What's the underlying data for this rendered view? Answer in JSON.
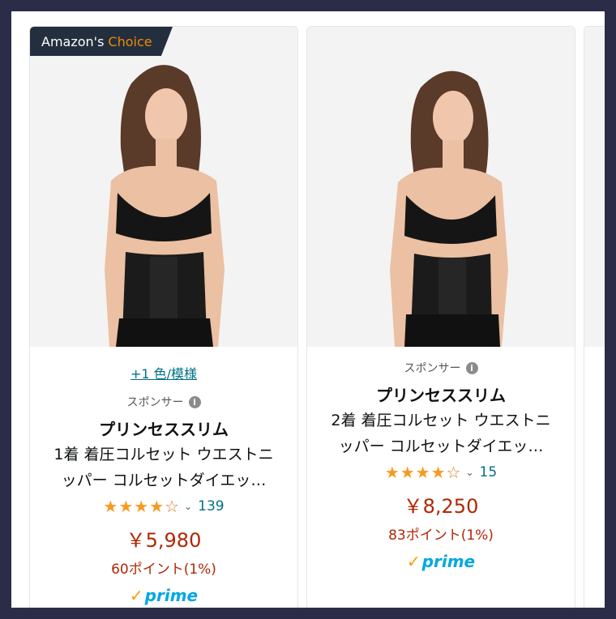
{
  "badge": {
    "amazons": "Amazon's",
    "choice": "Choice"
  },
  "cards": [
    {
      "variants": "+1 色/模様",
      "sponsor": "スポンサー",
      "brand": "プリンセススリム",
      "title_line1": "1着 着圧コルセット ウエストニ",
      "title_line2": "ッパー コルセットダイエッ…",
      "stars": "★★★★",
      "star_empty": "☆",
      "rating_value": 4.0,
      "review_count": "139",
      "price": "￥5,980",
      "points": "60ポイント(1%)",
      "prime": "prime"
    },
    {
      "sponsor": "スポンサー",
      "brand": "プリンセススリム",
      "title_line1": "2着 着圧コルセット ウエストニ",
      "title_line2": "ッパー コルセットダイエッ…",
      "stars": "★★★★",
      "star_empty": "☆",
      "rating_value": 4.0,
      "review_count": "15",
      "price": "￥8,250",
      "points": "83ポイント(1%)",
      "prime": "prime"
    }
  ],
  "colors": {
    "link": "#007185",
    "price": "#b12704",
    "star": "#f79a1f",
    "prime": "#00a8e1",
    "badge_bg": "#232f3e",
    "choice": "#f08804"
  },
  "icons": {
    "info": "info-icon",
    "chevron": "chevron-down-icon",
    "prime_check": "check-icon"
  }
}
